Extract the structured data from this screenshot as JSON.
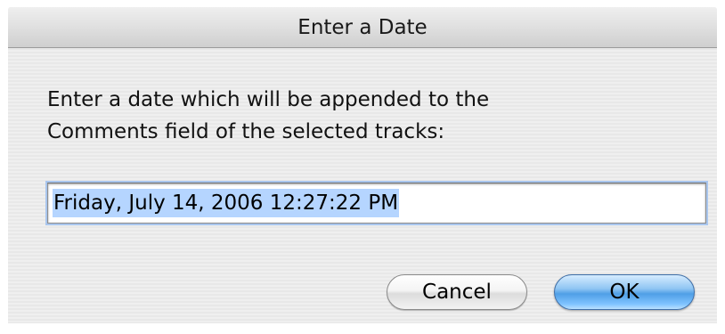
{
  "dialog": {
    "title": "Enter a Date",
    "prompt_line1": "Enter a date which will be appended to the",
    "prompt_line2": "Comments field of the selected tracks:",
    "date_value": "Friday, July 14, 2006 12:27:22 PM",
    "date_selected": true,
    "cancel_label": "Cancel",
    "ok_label": "OK",
    "default_button": "OK"
  },
  "colors": {
    "selection_highlight": "#b5d5ff",
    "default_button_blue": "#4f9fe6",
    "window_background": "#ececec"
  }
}
